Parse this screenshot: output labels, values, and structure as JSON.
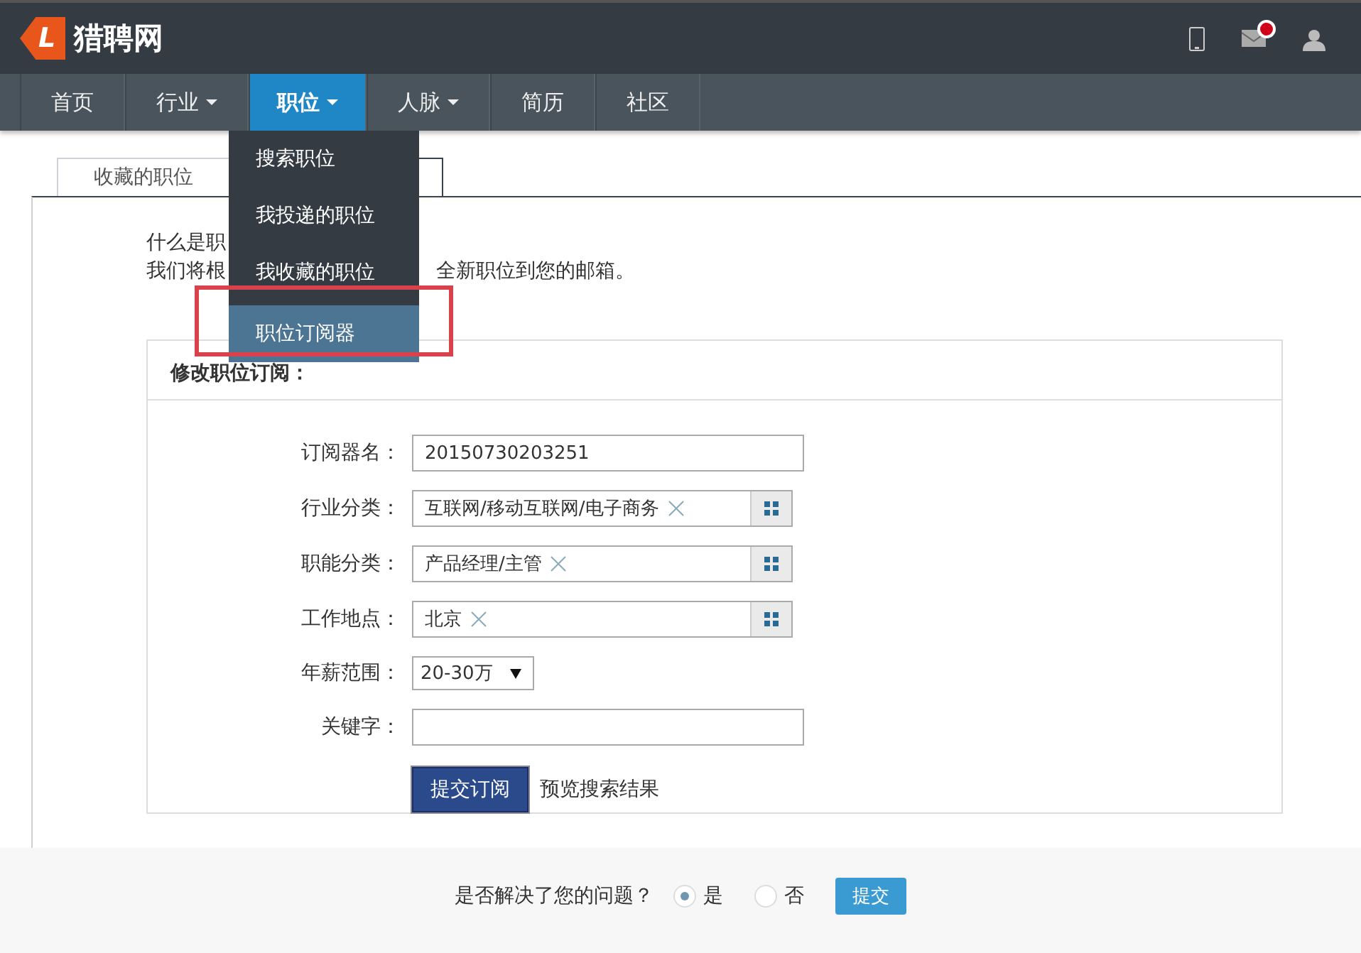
{
  "header": {
    "logo_letter": "L",
    "logo_text": "猎聘网",
    "mail_unread": true
  },
  "nav": [
    {
      "label": "首页",
      "has_menu": false,
      "selected": false
    },
    {
      "label": "行业",
      "has_menu": true,
      "selected": false
    },
    {
      "label": "职位",
      "has_menu": true,
      "selected": true
    },
    {
      "label": "人脉",
      "has_menu": true,
      "selected": false
    },
    {
      "label": "简历",
      "has_menu": false,
      "selected": false
    },
    {
      "label": "社区",
      "has_menu": false,
      "selected": false
    }
  ],
  "dropdown": [
    {
      "label": "搜索职位",
      "selected": false
    },
    {
      "label": "我投递的职位",
      "selected": false
    },
    {
      "label": "我收藏的职位",
      "selected": false
    },
    {
      "label": "职位订阅器",
      "selected": true
    }
  ],
  "tabs": [
    {
      "label": "收藏的职位",
      "selected": false
    }
  ],
  "intro": {
    "line_1": "什么是职",
    "line_2_start": "我们将根",
    "line_2_end": "全新职位到您的邮箱。"
  },
  "form": {
    "title": "修改职位订阅：",
    "fields": [
      {
        "kind": "text",
        "label": "订阅器名：",
        "value": "20150730203251"
      },
      {
        "kind": "picker",
        "label": "行业分类：",
        "value": "互联网/移动互联网/电子商务"
      },
      {
        "kind": "picker",
        "label": "职能分类：",
        "value": "产品经理/主管"
      },
      {
        "kind": "picker",
        "label": "工作地点：",
        "value": "北京"
      },
      {
        "kind": "select",
        "label": "年薪范围：",
        "value": "20-30万"
      },
      {
        "kind": "text",
        "label": "关键字："
      }
    ],
    "submit": "提交订阅",
    "preview": "预览搜索结果"
  },
  "feedback": {
    "question": "是否解决了您的问题？",
    "options": [
      {
        "label": "是",
        "selected": true
      },
      {
        "label": "否",
        "selected": false
      }
    ],
    "submit": "提交"
  }
}
